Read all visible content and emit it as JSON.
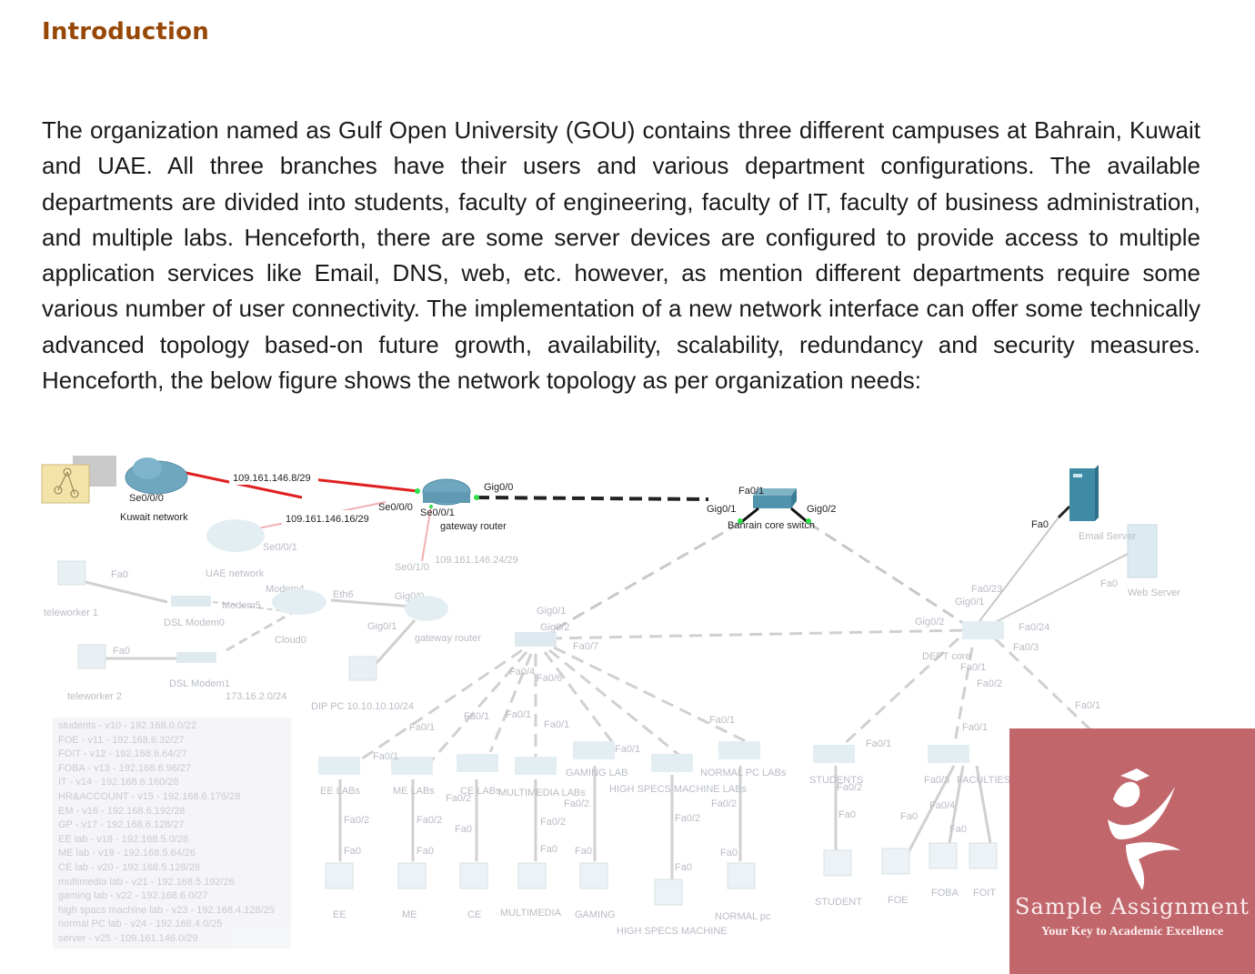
{
  "document": {
    "heading": "Introduction",
    "paragraph": "The organization named as Gulf Open University (GOU) contains three different campuses at Bahrain, Kuwait and UAE. All three branches have their users and various department configurations. The available departments are divided into students, faculty of engineering, faculty of IT, faculty of business administration, and multiple labs. Henceforth, there are some server devices are configured to provide access to multiple application services like Email, DNS, web, etc. however, as mention different departments require some various number of user connectivity. The implementation of a new network interface can offer some technically advanced topology based-on future growth, availability, scalability, redundancy and security measures. Henceforth, the below figure shows the network topology as per organization needs:"
  },
  "figure": {
    "wan": {
      "kuwait_network": "Kuwait network",
      "kuwait_port": "Se0/0/0",
      "uae_network": "UAE network",
      "uae_port": "Se0/0/1",
      "link1_subnet": "109.161.146.8/29",
      "link2_subnet": "109.161.146.16/29",
      "link3_subnet": "109.161.146.24/29",
      "gw_port_se000": "Se0/0/0",
      "gw_port_se001": "Se0/0/1",
      "gw_port_gig00": "Gig0/0",
      "gateway_router": "gateway router",
      "se010": "Se0/1/0"
    },
    "teleworkers": {
      "teleworker1": "teleworker 1",
      "teleworker2": "teleworker 2",
      "fa0": "Fa0",
      "dsl_modem0": "DSL Modem0",
      "dsl_modem1": "DSL Modem1",
      "modem4": "Modem4",
      "modem5": "Modem5",
      "cloud": "Cloud0",
      "eth6": "Eth6",
      "subnet": "173.16.2.0/24",
      "gig00": "Gig0/0",
      "gig01": "Gig0/1",
      "gateway2": "gateway router",
      "dip_pc": "DIP PC 10.10.10.10/24"
    },
    "core": {
      "fa01": "Fa0/1",
      "gig01": "Gig0/1",
      "gig02": "Gig0/2",
      "name": "Bahrain core switch"
    },
    "servers": {
      "email": "Email Server",
      "web": "Web Server",
      "fa0": "Fa0",
      "fa023": "Fa0/23",
      "fa024": "Fa0/24"
    },
    "lab_switch": {
      "gig01": "Gig0/1",
      "gig02": "Gig0/2",
      "fa07": "Fa0/7",
      "fa04": "Fa0/4",
      "fa06": "Fa0/6"
    },
    "labs": [
      {
        "switch": "EE LABs",
        "pc": "EE"
      },
      {
        "switch": "ME LABs",
        "pc": "ME"
      },
      {
        "switch": "CE LABs",
        "pc": "CE"
      },
      {
        "switch": "MULTIMEDIA LABs",
        "pc": "MULTIMEDIA"
      },
      {
        "switch": "GAMING LAB",
        "pc": "GAMING"
      },
      {
        "switch": "HIGH SPECS MACHINE LABs",
        "pc": "HIGH SPECS MACHINE"
      },
      {
        "switch": "NORMAL PC LABs",
        "pc": "NORMAL pc"
      }
    ],
    "dept": {
      "gig01": "Gig0/1",
      "gig02": "Gig0/2",
      "name": "DEPT core",
      "fa01": "Fa0/1",
      "fa02": "Fa0/2",
      "fa03": "Fa0/3",
      "fa024": "Fa0/24",
      "student_switch": "STUDENTS",
      "faculties_switch": "FACULTIES",
      "student_pc": "STUDENT",
      "foe_pc": "FOE",
      "foba_pc": "FOBA",
      "foit_pc": "FOIT",
      "fa04": "Fa0/4"
    },
    "port_labels": {
      "fa01": "Fa0/1",
      "fa02": "Fa0/2",
      "fa0": "Fa0"
    },
    "vlans": [
      "students - v10 - 192.168.0.0/22",
      "FOE - v11 - 192.168.6.32/27",
      "FOIT - v12 - 192.168.6.64/27",
      "FOBA - v13 - 192.168.6.96/27",
      "IT - v14 - 192.168.6.160/28",
      "HR&ACCOUNT - v15 - 192.168.6.176/28",
      "EM - v16 - 192.168.6.192/28",
      "GP - v17 - 192.168.6.128/27",
      "EE lab - v18 - 192.168.5.0/26",
      "ME lab - v19 - 192.168.5.64/26",
      "CE lab - v20 - 192.168.5.128/26",
      "multimedia lab - v21 - 192.168.5.192/26",
      "gaming lab - v22 - 192.168.6.0/27",
      "high spacs machine lab - v23 - 192.168.4.128/25",
      "normal PC lab - v24 - 192.168.4.0/25",
      "server - v25 - 109.161.146.0/29"
    ]
  },
  "watermark": {
    "title": "Sample Assignment",
    "tagline": "Your Key to Academic Excellence",
    "color": "#b85258"
  }
}
